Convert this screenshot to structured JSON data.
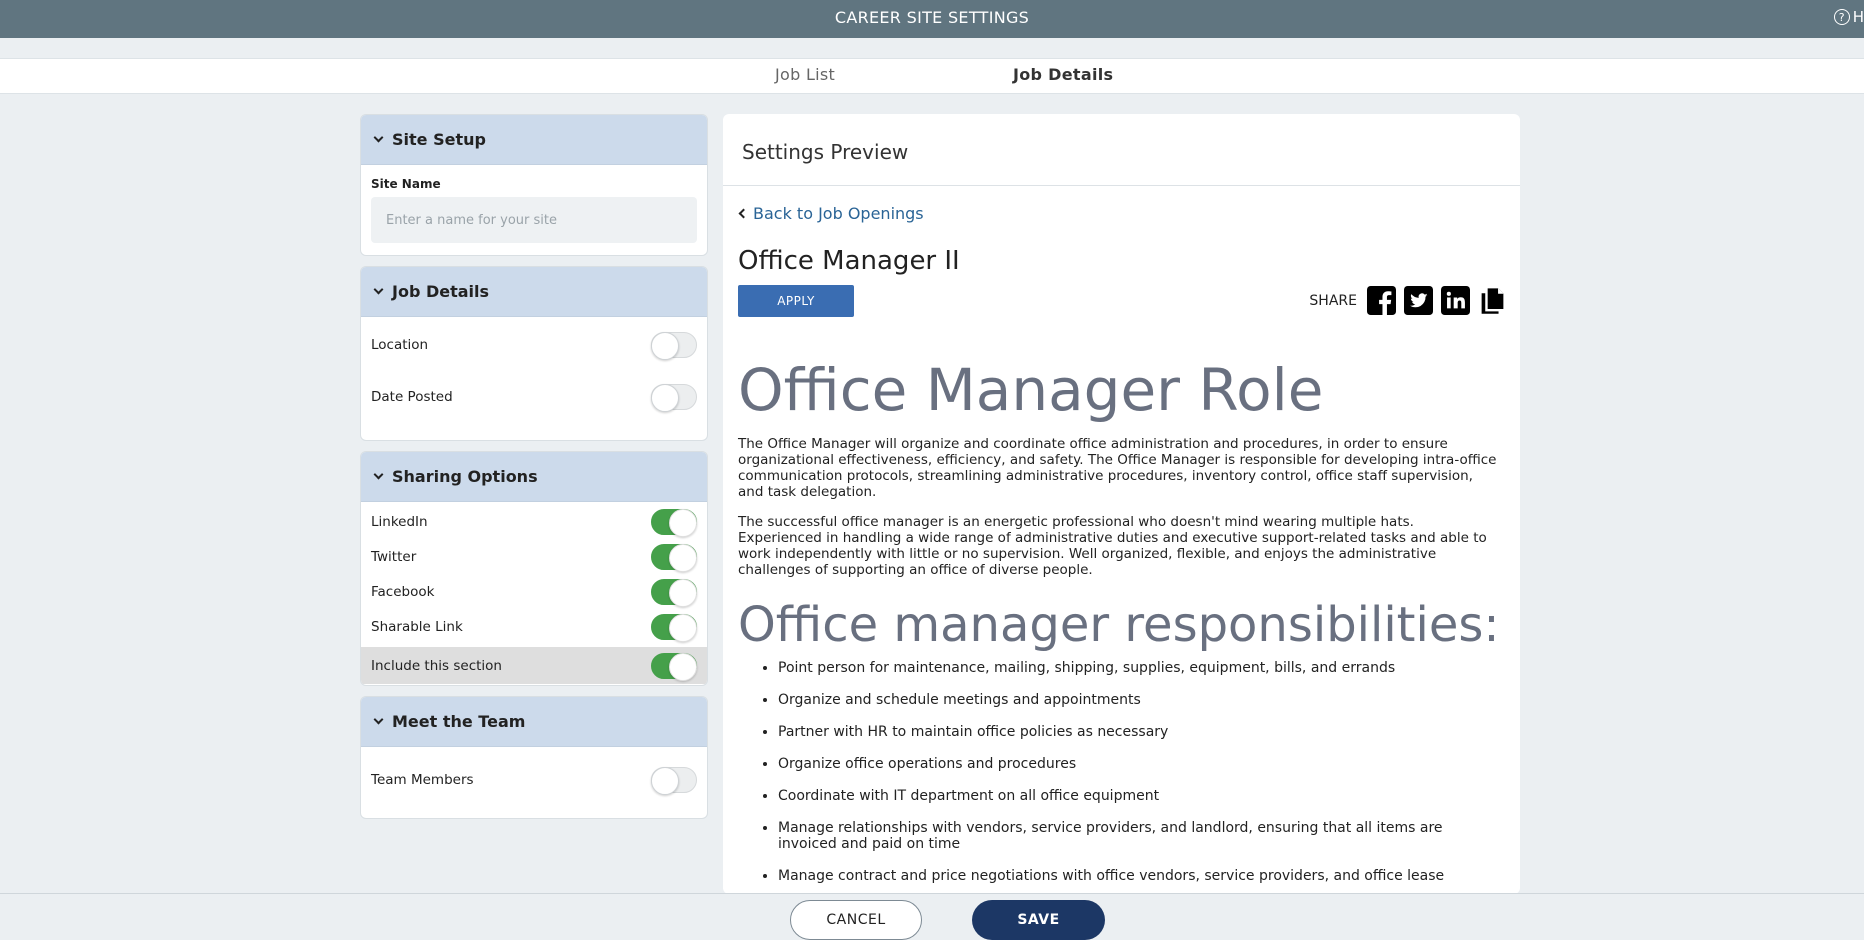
{
  "header": {
    "title": "CAREER SITE SETTINGS",
    "help_label": "H",
    "help_icon": "question-circle-icon"
  },
  "tabs": [
    {
      "label": "Job List",
      "active": false
    },
    {
      "label": "Job Details",
      "active": true
    }
  ],
  "site_setup": {
    "title": "Site Setup",
    "site_name_label": "Site Name",
    "site_name_placeholder": "Enter a name for your site",
    "site_name_value": ""
  },
  "job_details": {
    "title": "Job Details",
    "items": [
      {
        "label": "Location",
        "on": false
      },
      {
        "label": "Date Posted",
        "on": false
      }
    ]
  },
  "sharing": {
    "title": "Sharing Options",
    "items": [
      {
        "label": "LinkedIn",
        "on": true
      },
      {
        "label": "Twitter",
        "on": true
      },
      {
        "label": "Facebook",
        "on": true
      },
      {
        "label": "Sharable Link",
        "on": true
      }
    ],
    "include_label": "Include this section",
    "include_on": true
  },
  "team": {
    "title": "Meet the Team",
    "items": [
      {
        "label": "Team Members",
        "on": false
      }
    ]
  },
  "preview": {
    "title": "Settings Preview",
    "back_label": "Back to Job Openings",
    "job_title": "Office Manager II",
    "apply_label": "APPLY",
    "share_label": "SHARE",
    "share_icons": [
      "facebook-icon",
      "twitter-icon",
      "linkedin-icon",
      "copy-link-icon"
    ],
    "heading1": "Office Manager Role",
    "para1": "The Office Manager will organize and coordinate office administration and procedures, in order to ensure organizational effectiveness, efficiency, and safety. The Office Manager is responsible for developing intra-office communication protocols, streamlining administrative procedures, inventory control, office staff supervision, and task delegation.",
    "para2": "The successful office manager is an energetic professional who doesn't mind wearing multiple hats. Experienced in handling a wide range of administrative duties and executive support-related tasks and able to work independently with little or no supervision. Well organized, flexible, and enjoys the administrative challenges of supporting an office of diverse people.",
    "heading2": "Office manager responsibilities:",
    "responsibilities": [
      "Point person for maintenance, mailing, shipping, supplies, equipment, bills, and errands",
      "Organize and schedule meetings and appointments",
      "Partner with HR to maintain office policies as necessary",
      "Organize office operations and procedures",
      "Coordinate with IT department on all office equipment",
      "Manage relationships with vendors, service providers, and landlord, ensuring that all items are invoiced and paid on time",
      "Manage contract and price negotiations with office vendors, service providers, and office lease"
    ]
  },
  "footer": {
    "cancel_label": "CANCEL",
    "save_label": "SAVE"
  },
  "colors": {
    "header_bg": "#607580",
    "panel_head_bg": "#ccdaeb",
    "toggle_on": "#45a04a",
    "apply_bg": "#3a6db2",
    "save_bg": "#1c3765",
    "link": "#2a6496"
  }
}
